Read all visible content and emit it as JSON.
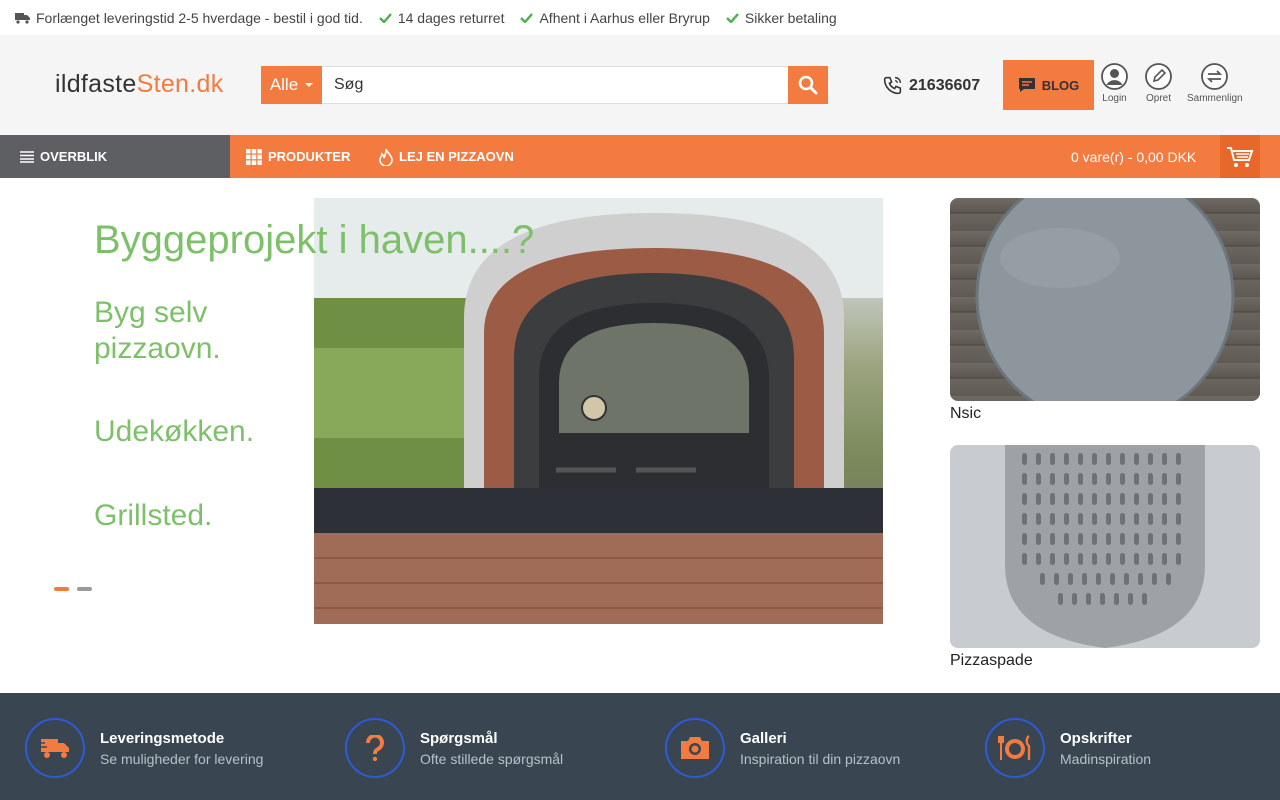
{
  "usp": {
    "items": [
      {
        "icon": "truck-icon",
        "text": "Forlænget leveringstid 2-5 hverdage - bestil i god tid."
      },
      {
        "icon": "check-icon",
        "text": "14 dages returret"
      },
      {
        "icon": "check-icon",
        "text": "Afhent i Aarhus eller Bryrup"
      },
      {
        "icon": "check-icon",
        "text": "Sikker betaling"
      }
    ]
  },
  "header": {
    "logo_part1": "ildfaste",
    "logo_part2": "Sten.dk",
    "search": {
      "category": "Alle",
      "placeholder": "Søg"
    },
    "phone": "21636607",
    "blog_label": "BLOG",
    "login_label": "Login",
    "create_label": "Opret",
    "compare_label": "Sammenlign"
  },
  "nav": {
    "overview_label": "OVERBLIK",
    "products_label": "PRODUKTER",
    "rent_label": "LEJ EN PIZZAOVN",
    "cart_text": "0 vare(r) - 0,00 DKK"
  },
  "hero": {
    "title": "Byggeprojekt i haven....?",
    "lines": [
      "Byg selv pizzaovn.",
      "Udekøkken.",
      "Grillsted."
    ],
    "active_slide": 1,
    "slide_count": 2
  },
  "side_products": [
    {
      "name": "Nsic"
    },
    {
      "name": "Pizzaspade"
    }
  ],
  "info": [
    {
      "icon": "delivery-truck-icon",
      "title": "Leveringsmetode",
      "subtitle": "Se muligheder for levering"
    },
    {
      "icon": "question-icon",
      "title": "Spørgsmål",
      "subtitle": "Ofte stillede spørgsmål"
    },
    {
      "icon": "camera-icon",
      "title": "Galleri",
      "subtitle": "Inspiration til din pizzaovn"
    },
    {
      "icon": "plate-cutlery-icon",
      "title": "Opskrifter",
      "subtitle": "Madinspiration"
    }
  ],
  "colors": {
    "accent": "#f47b3f",
    "nav_dark": "#5e5f63",
    "footer_bg": "#394550",
    "check_green": "#4caf50"
  }
}
